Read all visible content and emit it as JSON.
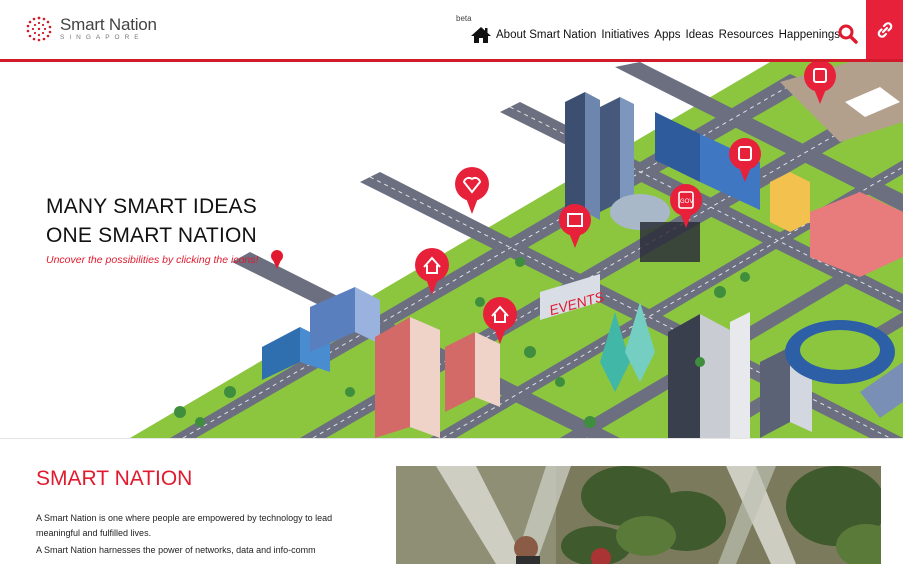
{
  "header": {
    "logo": {
      "name": "Smart Nation",
      "subtitle": "SINGAPORE"
    },
    "beta_label": "beta",
    "nav_items": [
      {
        "label": "About Smart Nation"
      },
      {
        "label": "Initiatives"
      },
      {
        "label": "Apps"
      },
      {
        "label": "Ideas"
      },
      {
        "label": "Resources"
      },
      {
        "label": "Happenings"
      }
    ],
    "search_icon": "search-icon",
    "link_icon": "link-icon"
  },
  "hero": {
    "title_line1": "MANY SMART IDEAS",
    "title_line2": "ONE SMART NATION",
    "subtitle": "Uncover the possibilities by clicking the icons!",
    "events_sign": "EVENTS",
    "gov_icon_label": "GOV",
    "blk_label": "BLK 71",
    "map_icons": [
      "heart-health-icon",
      "calendar-icon",
      "gov-icon",
      "home-icon",
      "home-icon",
      "bus-icon",
      "bus-icon"
    ]
  },
  "section": {
    "heading": "SMART NATION",
    "paragraph1": "A Smart Nation is one where people are empowered by technology to lead meaningful and fulfilled lives.",
    "paragraph2": "A Smart Nation harnesses the power of networks, data and info-comm"
  },
  "colors": {
    "brand_red": "#e01b2f",
    "header_line": "#d11a2a",
    "road": "#6b6f80",
    "grass": "#8cc63f"
  }
}
